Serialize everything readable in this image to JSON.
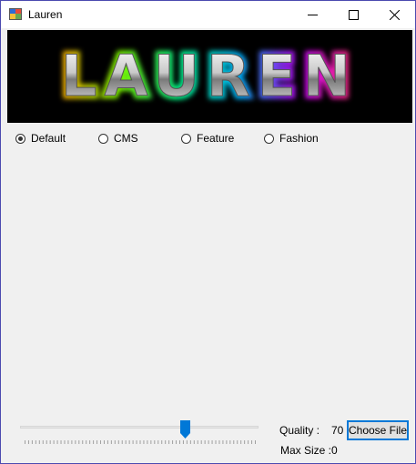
{
  "window": {
    "title": "Lauren"
  },
  "banner": {
    "text": "LAUREN"
  },
  "options": [
    {
      "label": "Default",
      "checked": true
    },
    {
      "label": "CMS",
      "checked": false
    },
    {
      "label": "Feature",
      "checked": false
    },
    {
      "label": "Fashion",
      "checked": false
    }
  ],
  "quality": {
    "label": "Quality :",
    "value": "70",
    "slider_value": 70,
    "slider_min": 0,
    "slider_max": 100
  },
  "maxsize": {
    "label": "Max Size :",
    "value": "0"
  },
  "choose_file": {
    "label": "Choose File"
  },
  "colors": {
    "accent": "#0078d7",
    "background": "#f0f0f0",
    "banner": "#000000"
  }
}
